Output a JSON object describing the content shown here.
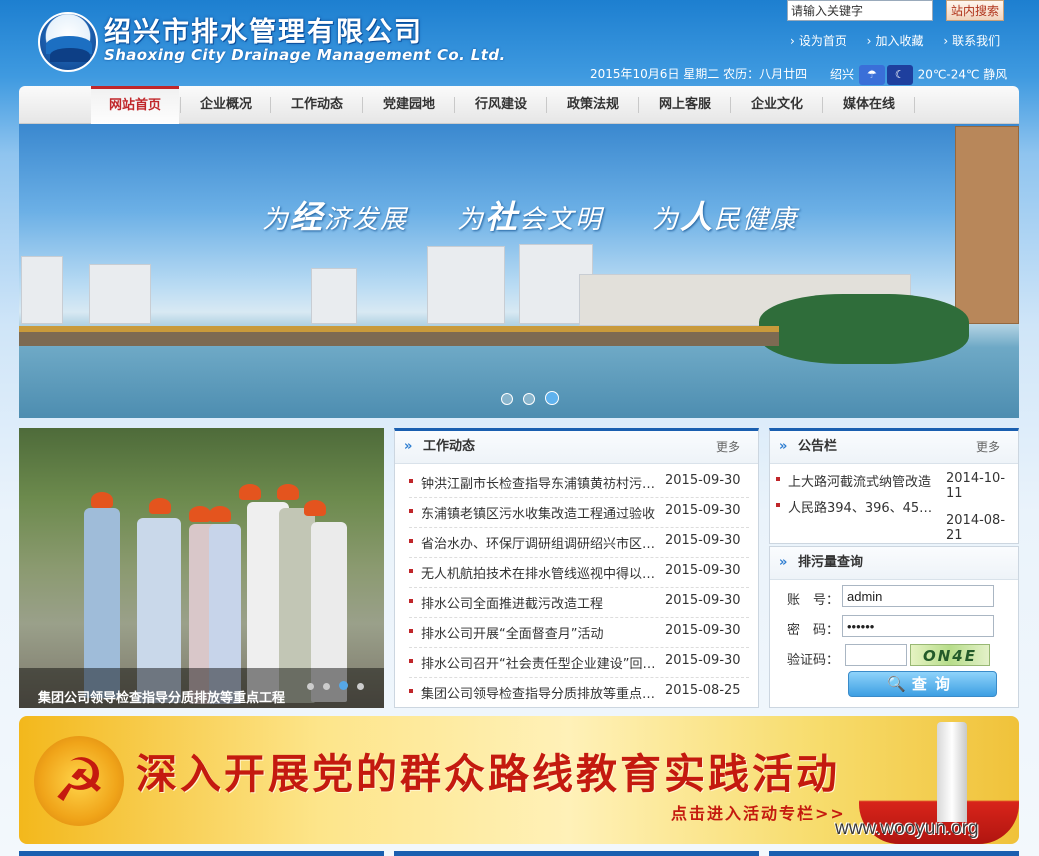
{
  "header": {
    "site_title": "绍兴市排水管理有限公司",
    "site_subtitle": "Shaoxing City Drainage Management Co. Ltd.",
    "search": {
      "placeholder": "请输入关键字",
      "button": "站内搜索"
    },
    "links": [
      "设为首页",
      "加入收藏",
      "联系我们"
    ],
    "date": "2015年10月6日 星期二 农历：八月廿四",
    "city": "绍兴",
    "weather_icons": [
      "rain-cloud-icon",
      "rain-night-icon"
    ],
    "temperature": "20℃-24℃ 静风"
  },
  "nav": {
    "items": [
      "网站首页",
      "企业概况",
      "工作动态",
      "党建园地",
      "行风建设",
      "政策法规",
      "网上客服",
      "企业文化",
      "媒体在线"
    ],
    "active": "网站首页"
  },
  "banner": {
    "slogans": [
      {
        "pre": "为",
        "big": "经",
        "post": "济发展"
      },
      {
        "pre": "为",
        "big": "社",
        "post": "会文明"
      },
      {
        "pre": "为",
        "big": "人",
        "post": "民健康"
      }
    ],
    "slide_count": 3,
    "active_slide": 3
  },
  "photo": {
    "caption": "集团公司领导检查指导分质排放等重点工程",
    "slide_count": 5,
    "active_slide": 4
  },
  "work_news": {
    "title": "工作动态",
    "more": "更多",
    "items": [
      {
        "title": "钟洪江副市长检查指导东浦镇黄祊村污水改造",
        "date": "2015-09-30"
      },
      {
        "title": "东浦镇老镇区污水收集改造工程通过验收",
        "date": "2015-09-30"
      },
      {
        "title": "省治水办、环保厅调研组调研绍兴市区污水处理",
        "date": "2015-09-30"
      },
      {
        "title": "无人机航拍技术在排水管线巡视中得以应用",
        "date": "2015-09-30"
      },
      {
        "title": "排水公司全面推进截污改造工程",
        "date": "2015-09-30"
      },
      {
        "title": "排水公司开展“全面督查月”活动",
        "date": "2015-09-30"
      },
      {
        "title": "排水公司召开“社会责任型企业建设”回头看会议",
        "date": "2015-09-30"
      },
      {
        "title": "集团公司领导检查指导分质排放等重点工程",
        "date": "2015-08-25"
      }
    ]
  },
  "notice": {
    "title": "公告栏",
    "more": "更多",
    "items": [
      {
        "title": "上大路河截流式纳管改造",
        "date": "2014-10-11"
      },
      {
        "title": "人民路394、396、45…",
        "date": "2014-08-21"
      }
    ]
  },
  "query": {
    "title": "排污量查询",
    "account_label": "账　号：",
    "account_value": "admin",
    "password_label": "密　码：",
    "password_value": "••••••",
    "captcha_label": "验证码：",
    "captcha_value": "",
    "captcha_image_text": "ON4E",
    "button": "查询"
  },
  "party_banner": {
    "title": "深入开展党的群众路线教育实践活动",
    "subtitle": "点击进入活动专栏>>"
  },
  "watermark": "www.wooyun.org",
  "colors": {
    "accent_red": "#c0262a",
    "accent_blue": "#1a5fb0",
    "party_red": "#c41a0f"
  }
}
